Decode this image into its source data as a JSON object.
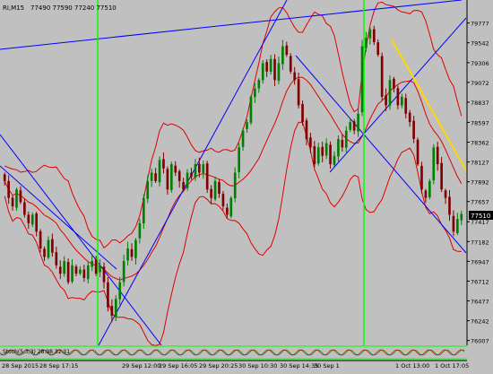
{
  "header": {
    "symbol_label": "RI,M15",
    "ohlc_text": "77490 77590 77240 77510"
  },
  "price_tag": "77510",
  "indicator_text": "Stoch(5,3,3) 28.98 32.31",
  "colors": {
    "background": "#c0c0c0",
    "bull_candle": "#008000",
    "bear_candle": "#800000",
    "bands": "#e00000",
    "trendlines": "#0000ff",
    "vertical_markers": "#00ff00",
    "highlight_line": "#ffd700",
    "axis_text": "#000000",
    "price_tag_bg": "#000000",
    "price_tag_fg": "#ffffff"
  },
  "chart_data": {
    "type": "candlestick",
    "symbol": "RI",
    "timeframe": "M15",
    "ylim": [
      75950,
      80050
    ],
    "y_ticks": [
      79777,
      79542,
      79306,
      79072,
      78837,
      78597,
      78362,
      78127,
      77892,
      77657,
      77417,
      77182,
      76947,
      76712,
      76477,
      76242,
      76007
    ],
    "x_ticks": [
      "28 Sep 2015",
      "28 Sep 17:15",
      "29 Sep 12:00",
      "29 Sep 16:05",
      "29 Sep 20:25",
      "30 Sep 10:30",
      "30 Sep 14:35",
      "30 Sep 1",
      "1 Oct 13:00",
      "1 Oct 17:05"
    ],
    "candle_closes": [
      77900,
      77700,
      77600,
      77800,
      77650,
      77500,
      77400,
      77500,
      77300,
      77100,
      77000,
      77200,
      77050,
      76900,
      76800,
      76950,
      76700,
      76900,
      76800,
      76850,
      76750,
      76900,
      76950,
      76800,
      76900,
      76700,
      76400,
      76300,
      76500,
      76700,
      76950,
      77100,
      77000,
      77200,
      77400,
      77700,
      77900,
      78000,
      77900,
      78150,
      78050,
      77800,
      78100,
      78000,
      77900,
      77800,
      78000,
      77950,
      78100,
      78000,
      78100,
      77800,
      77700,
      77900,
      77750,
      77600,
      77500,
      77700,
      78000,
      78300,
      78500,
      78600,
      78900,
      79000,
      79100,
      79300,
      79200,
      79350,
      79100,
      79300,
      79500,
      79400,
      79200,
      79100,
      78800,
      78600,
      78400,
      78300,
      78100,
      78300,
      78200,
      78350,
      78100,
      78200,
      78400,
      78300,
      78500,
      78600,
      78500,
      78700,
      79500,
      79600,
      79700,
      79550,
      79400,
      78900,
      78800,
      79100,
      79000,
      78800,
      78900,
      78700,
      78600,
      78400,
      78100,
      77800,
      77700,
      77900,
      78300,
      78100,
      77800,
      77700,
      77500,
      77300,
      77450,
      77510
    ],
    "last_price": 77510,
    "overlays": [
      "Bollinger Bands",
      "Trend lines"
    ],
    "subwindow": {
      "indicator": "Stochastic",
      "params": "5,3,3",
      "values": [
        28.98,
        32.31
      ]
    },
    "grid": false
  }
}
